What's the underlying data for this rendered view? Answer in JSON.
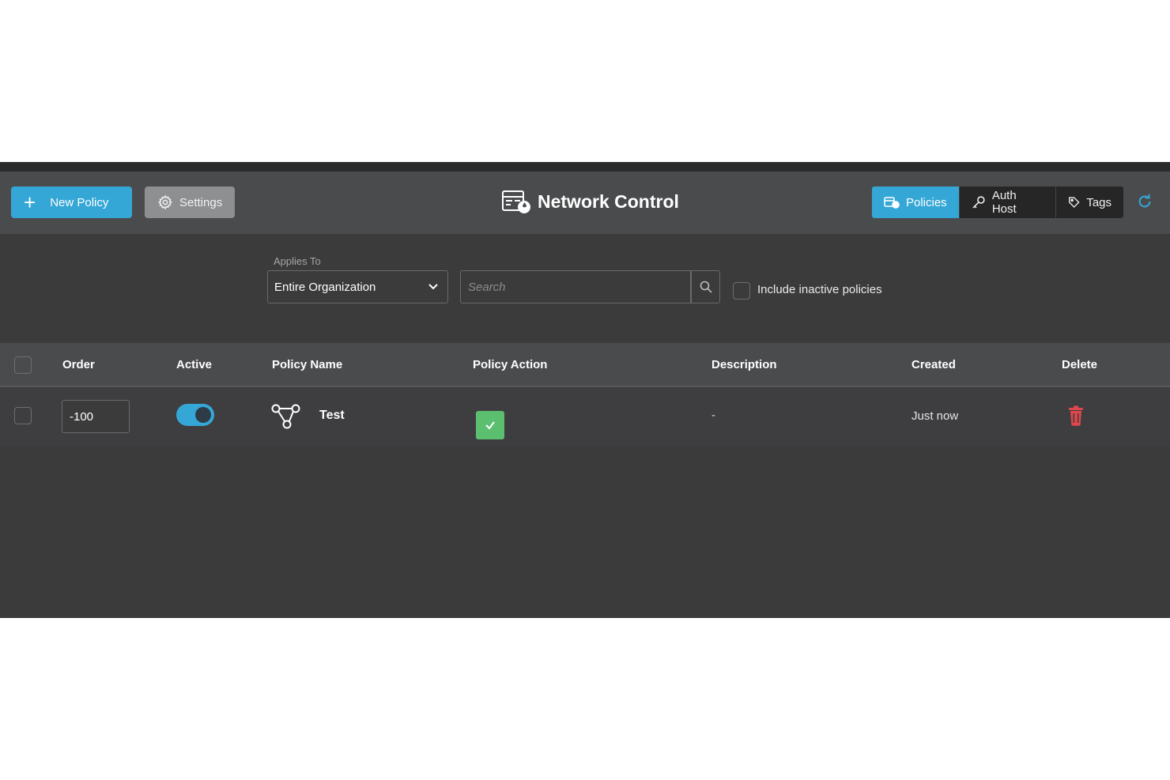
{
  "header": {
    "new_policy_label": "New Policy",
    "settings_label": "Settings",
    "title": "Network Control",
    "tabs": [
      {
        "label": "Policies",
        "icon": "policies-icon",
        "active": true
      },
      {
        "label": "Auth Host",
        "icon": "key-icon",
        "active": false
      },
      {
        "label": "Tags",
        "icon": "tag-icon",
        "active": false
      }
    ],
    "refresh_icon": "refresh-icon"
  },
  "filters": {
    "applies_to_label": "Applies To",
    "applies_to_value": "Entire Organization",
    "search_placeholder": "Search",
    "include_inactive_label": "Include inactive policies",
    "include_inactive_checked": false
  },
  "table": {
    "columns": [
      "Order",
      "Active",
      "Policy Name",
      "Policy Action",
      "Description",
      "Created",
      "Delete"
    ],
    "rows": [
      {
        "order": "-100",
        "active": true,
        "policy_name": "Test",
        "policy_action": "allow",
        "description": "-",
        "created": "Just now"
      }
    ]
  },
  "colors": {
    "accent": "#35a7d6",
    "header_bg": "#4a4b4d",
    "body_bg": "#3b3b3c",
    "allow_green": "#5cbf6f",
    "delete_red": "#e0474c"
  }
}
